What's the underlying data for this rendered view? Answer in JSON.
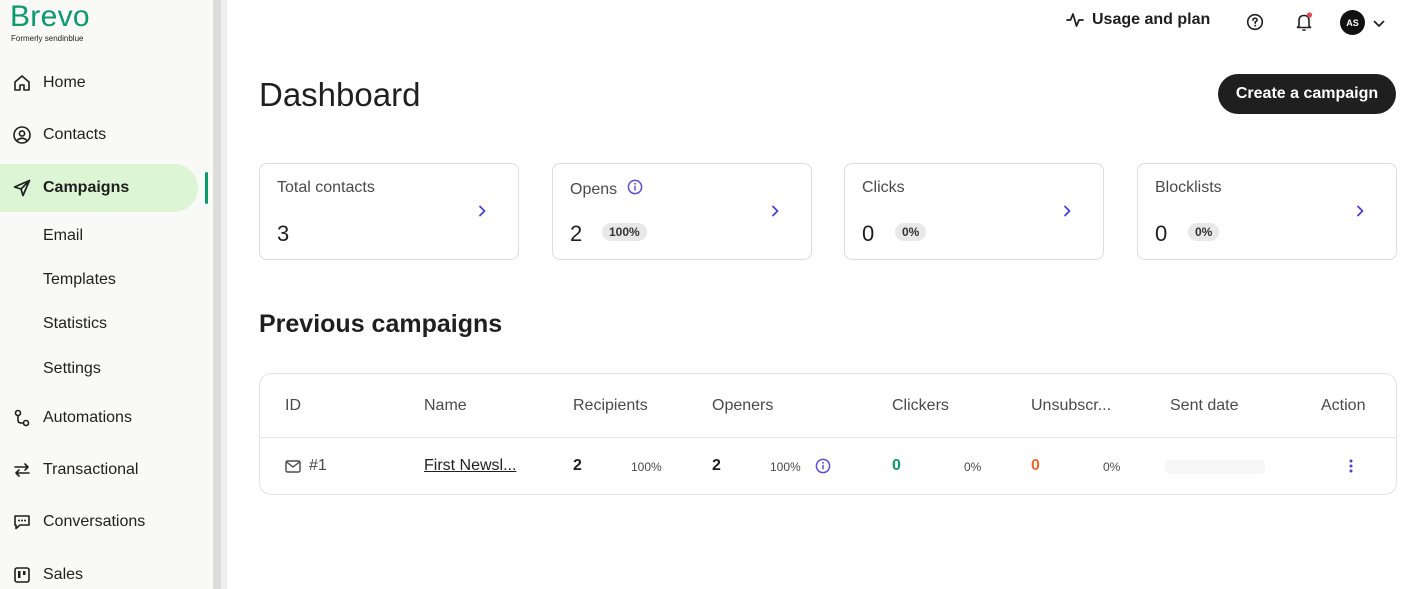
{
  "brand": {
    "name": "Brevo",
    "sub": "Formerly sendinblue",
    "color": "#0b996e"
  },
  "sidebar": {
    "items": [
      {
        "label": "Home",
        "icon": "home-icon"
      },
      {
        "label": "Contacts",
        "icon": "contacts-icon"
      },
      {
        "label": "Campaigns",
        "icon": "send-icon",
        "active": true
      },
      {
        "label": "Automations",
        "icon": "automations-icon"
      },
      {
        "label": "Transactional",
        "icon": "transactional-icon"
      },
      {
        "label": "Conversations",
        "icon": "chat-icon"
      },
      {
        "label": "Sales",
        "icon": "sales-icon"
      }
    ],
    "sub_items": [
      "Email",
      "Templates",
      "Statistics",
      "Settings"
    ]
  },
  "topbar": {
    "usage_label": "Usage and plan",
    "avatar_initials": "AS"
  },
  "page": {
    "title": "Dashboard",
    "create_button": "Create a campaign"
  },
  "stats": [
    {
      "label": "Total contacts",
      "value": "3",
      "badge": ""
    },
    {
      "label": "Opens",
      "value": "2",
      "badge": "100%"
    },
    {
      "label": "Clicks",
      "value": "0",
      "badge": "0%"
    },
    {
      "label": "Blocklists",
      "value": "0",
      "badge": "0%"
    }
  ],
  "previous": {
    "title": "Previous campaigns",
    "columns": [
      "ID",
      "Name",
      "Recipients",
      "Openers",
      "Clickers",
      "Unsubscr...",
      "Sent date",
      "Action"
    ],
    "rows": [
      {
        "id": "#1",
        "name": "First Newsl...",
        "recipients": "2",
        "recipients_pct": "100%",
        "openers": "2",
        "openers_pct": "100%",
        "clickers": "0",
        "clickers_pct": "0%",
        "unsub": "0",
        "unsub_pct": "0%"
      }
    ]
  },
  "colors": {
    "accent": "#0b996e",
    "active_bg": "#dcf5d4",
    "info": "#5b4ed8",
    "unsub": "#f06a2e"
  }
}
